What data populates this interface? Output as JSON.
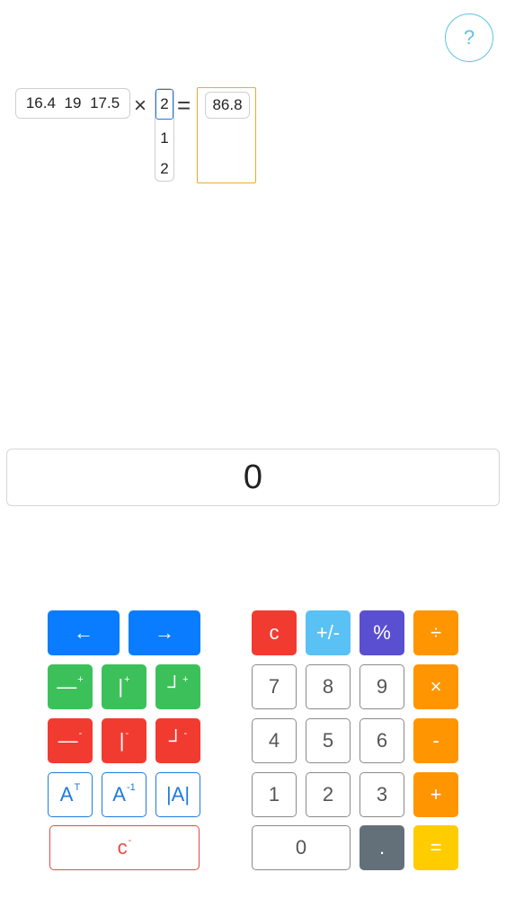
{
  "help": {
    "label": "?"
  },
  "expression": {
    "matrix_a": [
      "16.4",
      "19",
      "17.5"
    ],
    "times": "×",
    "vector_b": [
      "2",
      "1",
      "2"
    ],
    "equals": "=",
    "result": "86.8"
  },
  "display": {
    "value": "0"
  },
  "matrix_keys": {
    "left_arrow": "←",
    "right_arrow": "→",
    "add_row_main": "—",
    "add_row_sup": "+",
    "add_col_main": "|",
    "add_col_sup": "+",
    "add_both_main": "┘",
    "add_both_sup": "+",
    "del_row_main": "—",
    "del_row_sup": "-",
    "del_col_main": "|",
    "del_col_sup": "-",
    "del_both_main": "┘",
    "del_both_sup": "-",
    "transpose_main": "A",
    "transpose_sup": "T",
    "inverse_main": "A",
    "inverse_sup": "-1",
    "determinant": "|A|",
    "clear_matrix_main": "c",
    "clear_matrix_sup": "-"
  },
  "number_keys": {
    "clear": "c",
    "sign": "+/-",
    "percent": "%",
    "divide": "÷",
    "seven": "7",
    "eight": "8",
    "nine": "9",
    "multiply": "×",
    "four": "4",
    "five": "5",
    "six": "6",
    "minus": "-",
    "one": "1",
    "two": "2",
    "three": "3",
    "plus": "+",
    "zero": "0",
    "dot": ".",
    "equals": "="
  }
}
